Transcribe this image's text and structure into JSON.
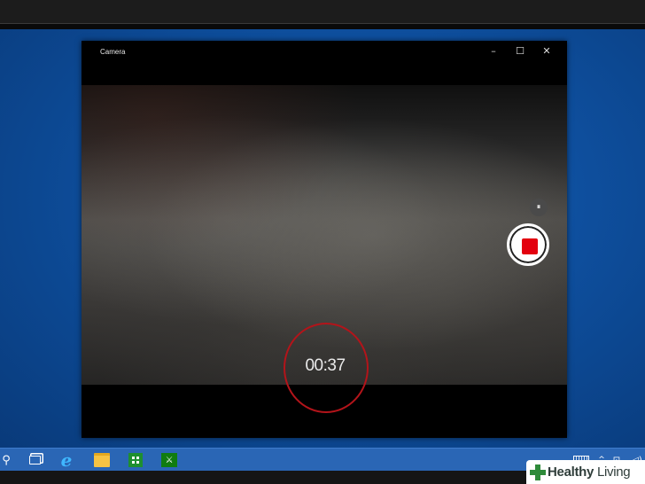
{
  "window": {
    "title": "Camera",
    "minimize_glyph": "–",
    "maximize_glyph": "☐",
    "close_glyph": "✕"
  },
  "recording": {
    "elapsed": "00:37",
    "pause_glyph": "⏸",
    "stop_color": "#e3000f",
    "highlight_ring_color": "#b3141a"
  },
  "taskbar": {
    "search_glyph": "⚲",
    "edge_glyph": "e",
    "xbox_glyph": "⚔",
    "chevron_glyph": "^",
    "network_glyph": "⊡",
    "volume_glyph": "◁)",
    "color": "#2a66b5"
  },
  "watermark": {
    "brand_bold": "Healthy",
    "brand_light": " Living"
  },
  "icons": [
    "search-icon",
    "task-view-icon",
    "edge-icon",
    "explorer-icon",
    "store-icon",
    "xbox-icon",
    "keyboard-icon",
    "tray-chevron-icon",
    "network-icon",
    "volume-icon"
  ]
}
